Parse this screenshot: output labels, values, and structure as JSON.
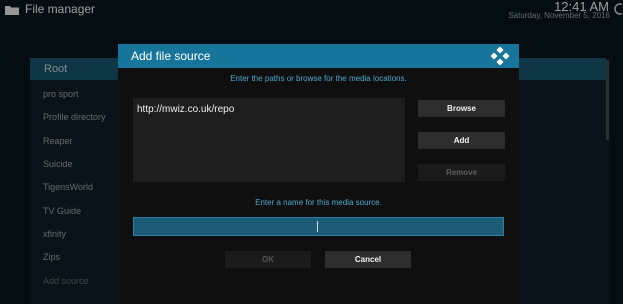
{
  "window": {
    "title": "File manager",
    "time": "12:41 AM",
    "date": "Saturday, November 5, 2016"
  },
  "list": {
    "header": "Root",
    "items": [
      {
        "label": "pro sport"
      },
      {
        "label": "Profile directory"
      },
      {
        "label": "Reaper"
      },
      {
        "label": "Suicide"
      },
      {
        "label": "TigensWorld"
      },
      {
        "label": "TV Guide"
      },
      {
        "label": "xfinity"
      },
      {
        "label": "Zips"
      },
      {
        "label": "Add source"
      }
    ]
  },
  "dialog": {
    "title": "Add file source",
    "paths_hint": "Enter the paths or browse for the media locations.",
    "paths": [
      "http://mwiz.co.uk/repo"
    ],
    "browse_label": "Browse",
    "add_label": "Add",
    "remove_label": "Remove",
    "name_hint": "Enter a name for this media source.",
    "name_value": "",
    "ok_label": "OK",
    "cancel_label": "Cancel"
  },
  "colors": {
    "accent": "#17749a",
    "hint_text": "#4fa8d0",
    "background": "#06141c"
  },
  "icons": {
    "app": "folder-icon",
    "dialog": "kodi-logo-icon"
  }
}
